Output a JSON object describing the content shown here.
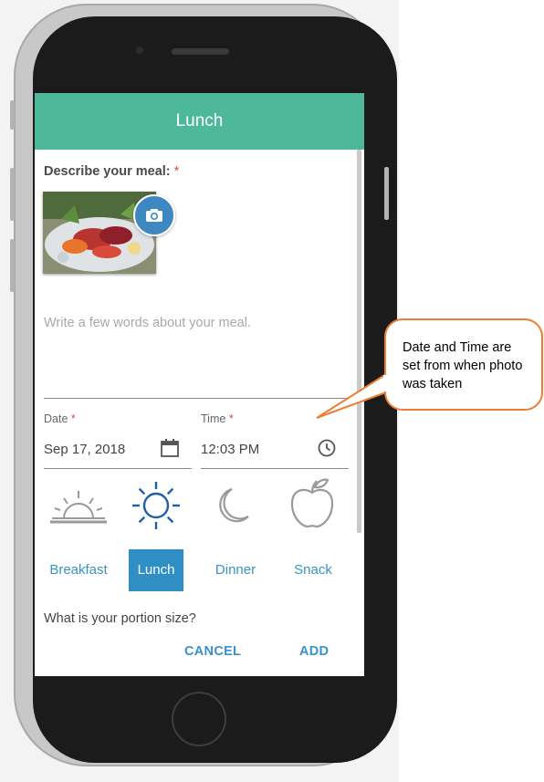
{
  "header": {
    "title": "Lunch"
  },
  "form": {
    "describe_label": "Describe your meal:",
    "required_mark": "*",
    "description_placeholder": "Write a few words about your meal.",
    "date": {
      "label": "Date",
      "value": "Sep 17, 2018"
    },
    "time": {
      "label": "Time",
      "value": "12:03 PM"
    }
  },
  "meal_types": [
    {
      "label": "Breakfast",
      "icon": "sunrise-icon",
      "selected": false
    },
    {
      "label": "Lunch",
      "icon": "sun-icon",
      "selected": true
    },
    {
      "label": "Dinner",
      "icon": "moon-icon",
      "selected": false
    },
    {
      "label": "Snack",
      "icon": "apple-icon",
      "selected": false
    }
  ],
  "portion_question": "What is your portion size?",
  "actions": {
    "cancel": "CANCEL",
    "add": "ADD"
  },
  "callout": {
    "text": "Date and Time are set from when photo was taken"
  },
  "colors": {
    "header": "#4eb89b",
    "accent": "#3a93c8",
    "callout_border": "#ed7d31",
    "required": "#e24a4a"
  }
}
